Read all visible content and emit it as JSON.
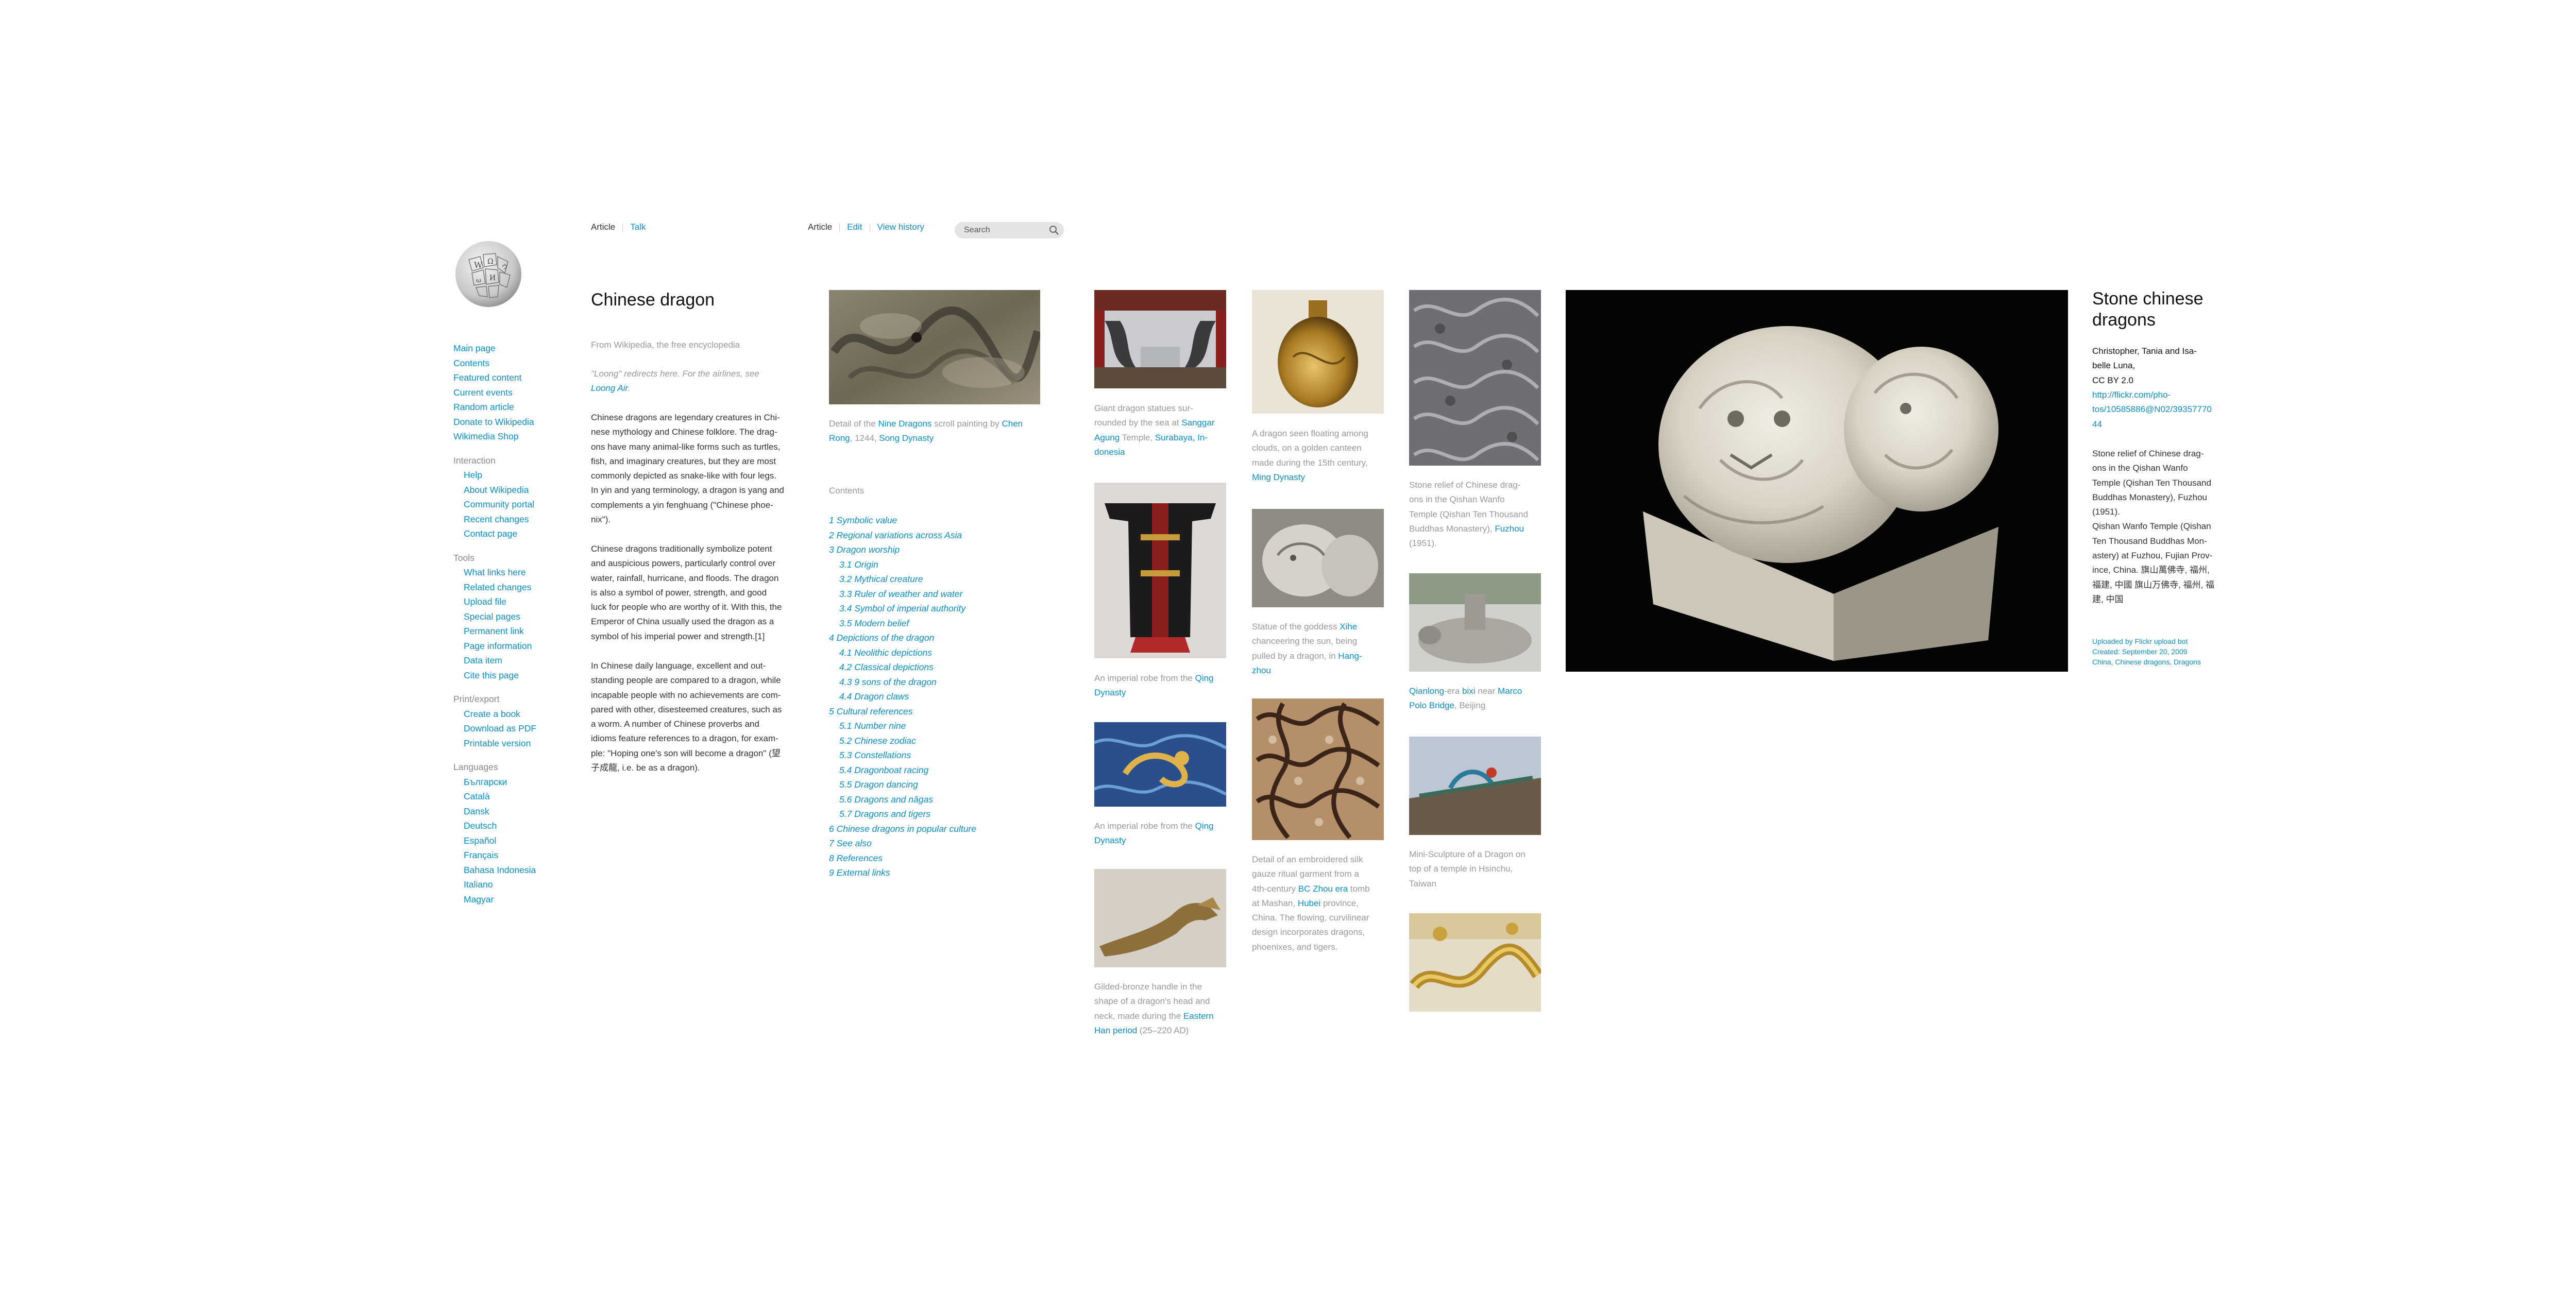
{
  "nav": {
    "left_tabs": [
      "Article",
      "Talk"
    ],
    "right_tabs": [
      "Article",
      "Edit",
      "View history"
    ],
    "search_placeholder": "Search"
  },
  "sidebar": {
    "main": [
      "Main page",
      "Contents",
      "Featured content",
      "Current events",
      "Random article",
      "Donate to Wikipedia",
      "Wikimedia Shop"
    ],
    "interaction_header": "Interaction",
    "interaction": [
      "Help",
      "About Wikipedia",
      "Community portal",
      "Recent changes",
      "Contact page"
    ],
    "tools_header": "Tools",
    "tools": [
      "What links here",
      "Related changes",
      "Upload file",
      "Special pages",
      "Permanent link",
      "Page information",
      "Data item",
      "Cite this page"
    ],
    "print_header": "Print/export",
    "print": [
      "Create a book",
      "Download as PDF",
      "Printable version"
    ],
    "languages_header": "Languages",
    "languages": [
      "Български",
      "Català",
      "Dansk",
      "Deutsch",
      "Español",
      "Français",
      "Bahasa Indonesia",
      "Italiano",
      "Magyar"
    ]
  },
  "article": {
    "title": "Chinese dragon",
    "from": "From Wikipedia, the free encyclopedia",
    "hatnote_1": "\"Loong\" redirects here. For the airlines, see",
    "hatnote_link": "Loong Air",
    "hatnote_end": ".",
    "p1": [
      "Chinese dragons are legendary creatures in Chi-",
      "nese mythology and Chinese folklore. The drag-",
      "ons have many animal-like forms such as turtles,",
      "fish, and imaginary creatures, but they are most",
      "commonly depicted as snake-like with four legs.",
      "In yin and yang terminology, a dragon is yang and",
      "complements a yin fenghuang (\"Chinese phoe-",
      "nix\")."
    ],
    "p2": [
      "Chinese dragons traditionally symbolize potent",
      "and auspicious powers, particularly control over",
      "water, rainfall, hurricane, and floods. The dragon",
      "is also a symbol of power, strength, and good",
      "luck for people who are worthy of it. With this, the",
      "Emperor of China usually used the dragon as a",
      "symbol of his imperial power and strength.[1]"
    ],
    "p3": [
      "In Chinese daily language, excellent and out-",
      "standing people are compared to a dragon, while",
      "incapable people with no achievements are com-",
      "pared with other, disesteemed creatures, such as",
      "a worm. A number of Chinese proverbs and",
      "idioms feature references to a dragon, for exam-",
      "ple: \"Hoping one's son will become a dragon\" (望",
      "子成龍, i.e. be as a dragon)."
    ]
  },
  "toc": {
    "caption_1": "Detail of the ",
    "caption_link1": "Nine Dragons",
    "caption_2": " scroll painting by ",
    "caption_link2": "Chen",
    "caption_link2b": "Rong",
    "caption_3": ", 1244, ",
    "caption_link3": "Song Dynasty",
    "header": "Contents",
    "items": [
      {
        "t": "1 Symbolic value",
        "s": false
      },
      {
        "t": "2 Regional variations across Asia",
        "s": false
      },
      {
        "t": "3 Dragon worship",
        "s": false
      },
      {
        "t": "3.1 Origin",
        "s": true
      },
      {
        "t": "3.2 Mythical creature",
        "s": true
      },
      {
        "t": "3.3 Ruler of weather and water",
        "s": true
      },
      {
        "t": "3.4 Symbol of imperial authority",
        "s": true
      },
      {
        "t": "3.5 Modern belief",
        "s": true
      },
      {
        "t": "4 Depictions of the dragon",
        "s": false
      },
      {
        "t": "4.1 Neolithic depictions",
        "s": true
      },
      {
        "t": "4.2 Classical depictions",
        "s": true
      },
      {
        "t": "4.3 9 sons of the dragon",
        "s": true
      },
      {
        "t": "4.4 Dragon claws",
        "s": true
      },
      {
        "t": "5 Cultural references",
        "s": false
      },
      {
        "t": "5.1 Number nine",
        "s": true
      },
      {
        "t": "5.2 Chinese zodiac",
        "s": true
      },
      {
        "t": "5.3 Constellations",
        "s": true
      },
      {
        "t": "5.4 Dragonboat racing",
        "s": true
      },
      {
        "t": "5.5 Dragon dancing",
        "s": true
      },
      {
        "t": "5.6 Dragons and nāgas",
        "s": true
      },
      {
        "t": "5.7 Dragons and tigers",
        "s": true
      },
      {
        "t": "6 Chinese dragons in popular culture",
        "s": false
      },
      {
        "t": "7 See also",
        "s": false
      },
      {
        "t": "8 References",
        "s": false
      },
      {
        "t": "9 External links",
        "s": false
      }
    ]
  },
  "captions": {
    "c1": {
      "a": "Giant dragon statues sur-",
      "b": "rounded by the sea at ",
      "l1": "Sanggar",
      "l2": "Agung",
      "c": " Temple, ",
      "l3": "Surabaya, In-",
      "l4": "donesia"
    },
    "c2": {
      "a": "An imperial robe from the ",
      "l1": "Qing",
      "l2": "Dynasty"
    },
    "c3": {
      "a": "An imperial robe from the ",
      "l1": "Qing",
      "l2": "Dynasty"
    },
    "c4": {
      "a": "Gilded-bronze handle in the",
      "b": "shape of a dragon's head and",
      "c": "neck, made during the ",
      "l1": "Eastern",
      "l2": "Han period",
      "d": " (25–220 AD)"
    },
    "c5": {
      "a": "A dragon seen floating among",
      "b": "clouds, on a golden canteen",
      "c": "made during the 15th century,",
      "l1": "Ming Dynasty"
    },
    "c6": {
      "a": "Statue of the goddess ",
      "l1": "Xihe",
      "b": "chanceering the sun, being",
      "c": "pulled by a dragon, in ",
      "l2": "Hang-",
      "l3": "zhou"
    },
    "c7": {
      "lines": [
        "Detail of an embroidered silk",
        "gauze ritual garment from a",
        "4th-century "
      ],
      "l1": "BC Zhou era",
      "d": " tomb",
      "e": "at Mashan, ",
      "l2": "Hubei",
      "f": " province,",
      "g": [
        "China. The flowing, curvilinear",
        "design incorporates dragons,",
        "phoenixes, and tigers."
      ]
    },
    "c8": {
      "lines": [
        "Stone relief of Chinese drag-",
        "ons in the Qishan Wanfo",
        "Temple (Qishan Ten Thousand",
        "Buddhas Monastery), "
      ],
      "l1": "Fuzhou",
      "d": "(1951)."
    },
    "c9": {
      "l1": "Qianlong",
      "a": "-era ",
      "l2": "bixi",
      "b": " near ",
      "l3": "Marco",
      "l4": "Polo Bridge",
      "c": ", Beijing"
    },
    "c10": {
      "lines": [
        "Mini-Sculpture of a Dragon on",
        "top of a temple in Hsinchu,",
        "Taiwan"
      ]
    }
  },
  "detail": {
    "title_lines": [
      "Stone chinese",
      "dragons"
    ],
    "author_lines": [
      "Christopher, Tania and Isa-",
      "belle Luna,",
      "CC BY 2.0"
    ],
    "url_lines": [
      "http://flickr.com/pho-",
      "tos/10585886@N02/39357770",
      "44"
    ],
    "desc_lines": [
      "Stone relief of Chinese drag-",
      "ons in the Qishan Wanfo",
      "Temple (Qishan Ten Thousand",
      "Buddhas Monastery), Fuzhou",
      "(1951).",
      "Qishan Wanfo Temple (Qishan",
      "Ten Thousand Buddhas Mon-",
      "astery) at Fuzhou, Fujian Prov-",
      "ince, China. 旗山萬佛寺, 福州,",
      "福建, 中國 旗山万佛寺, 福州, 福",
      "建, 中国"
    ],
    "meta": [
      "Uploaded by Flickr upload bot",
      "Created: September 20, 2009",
      "China, Chinese dragons, Dragons"
    ]
  },
  "colors": {
    "link": "#0b8fc6",
    "muted": "#999999",
    "text": "#333333"
  }
}
